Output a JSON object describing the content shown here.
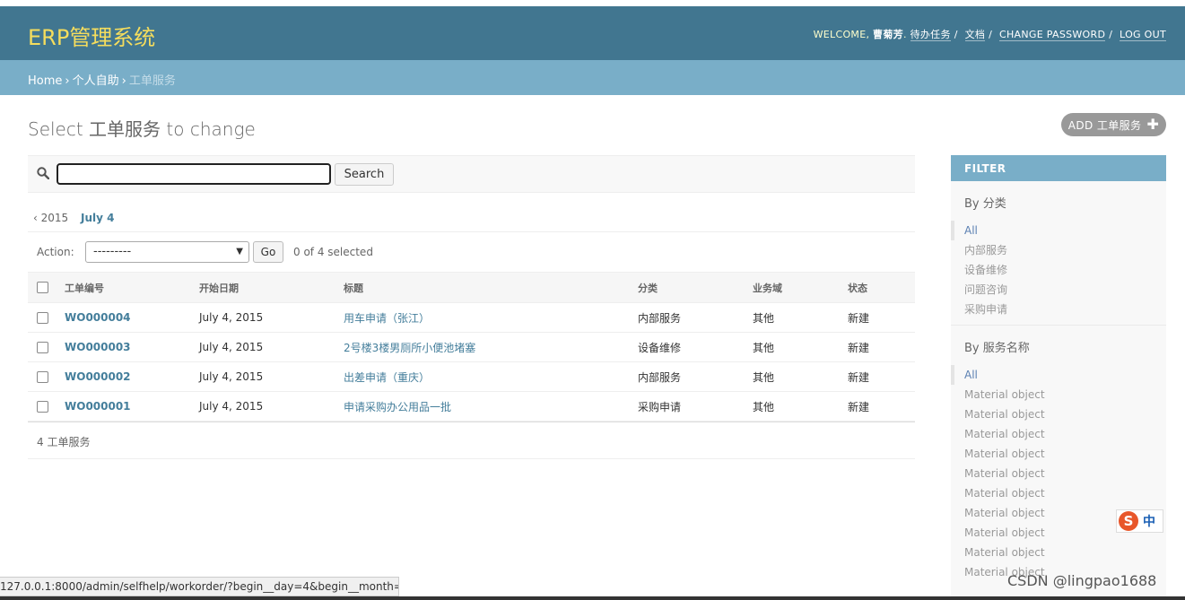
{
  "header": {
    "brand": "ERP管理系统",
    "welcome": "WELCOME,",
    "username": "曹菊芳",
    "links": [
      "待办任务",
      "文档",
      "CHANGE PASSWORD",
      "LOG OUT"
    ]
  },
  "breadcrumbs": [
    "Home",
    "个人自助",
    "工单服务"
  ],
  "page_title": "Select 工单服务 to change",
  "add_button": "ADD 工单服务",
  "search": {
    "value": "",
    "button": "Search"
  },
  "date_hierarchy": {
    "prev": "‹ 2015",
    "current": "July 4"
  },
  "actions": {
    "label": "Action:",
    "selected": "---------",
    "go": "Go",
    "count": "0 of 4 selected"
  },
  "table": {
    "columns": [
      "工单编号",
      "开始日期",
      "标题",
      "分类",
      "业务域",
      "状态"
    ],
    "rows": [
      {
        "id": "WO000004",
        "date": "July 4, 2015",
        "title": "用车申请（张江）",
        "category": "内部服务",
        "domain": "其他",
        "status": "新建"
      },
      {
        "id": "WO000003",
        "date": "July 4, 2015",
        "title": "2号楼3楼男厕所小便池堵塞",
        "category": "设备维修",
        "domain": "其他",
        "status": "新建"
      },
      {
        "id": "WO000002",
        "date": "July 4, 2015",
        "title": "出差申请（重庆）",
        "category": "内部服务",
        "domain": "其他",
        "status": "新建"
      },
      {
        "id": "WO000001",
        "date": "July 4, 2015",
        "title": "申请采购办公用品一批",
        "category": "采购申请",
        "domain": "其他",
        "status": "新建"
      }
    ]
  },
  "paginator": "4 工单服务",
  "filter": {
    "title": "FILTER",
    "groups": [
      {
        "heading": "By 分类",
        "items": [
          "All",
          "内部服务",
          "设备维修",
          "问题咨询",
          "采购申请"
        ]
      },
      {
        "heading": "By 服务名称",
        "items": [
          "All",
          "Material object",
          "Material object",
          "Material object",
          "Material object",
          "Material object",
          "Material object",
          "Material object",
          "Material object",
          "Material object",
          "Material object"
        ]
      }
    ]
  },
  "status_bar": "127.0.0.1:8000/admin/selfhelp/workorder/?begin__day=4&begin__month=...",
  "ime": {
    "s": "S",
    "zh": "中"
  },
  "watermark": "CSDN @lingpao1688",
  "colors": {
    "header": "#417690",
    "breadcrumbs": "#79aec8",
    "brand": "#f5dd5d",
    "link": "#447e9b"
  }
}
